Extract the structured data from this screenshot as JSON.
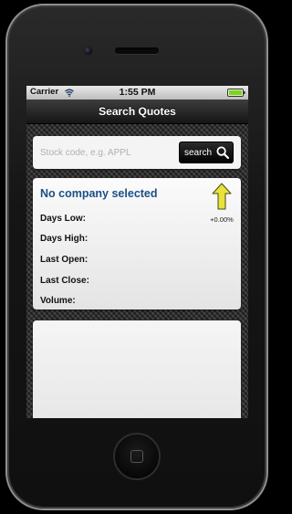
{
  "status_bar": {
    "carrier": "Carrier",
    "time": "1:55 PM"
  },
  "nav": {
    "title": "Search Quotes"
  },
  "search": {
    "placeholder": "Stock code, e.g. APPL",
    "button_label": "search"
  },
  "quote": {
    "company": "No company selected",
    "change": "+0.00%",
    "fields": [
      "Days Low:",
      "Days High:",
      "Last Open:",
      "Last Close:",
      "Volume:"
    ]
  },
  "colors": {
    "company_text": "#1b4f86",
    "arrow_fill": "#e8e23a",
    "battery_fill": "#7ed321"
  },
  "icons": {
    "wifi": "wifi-icon",
    "battery": "battery-icon",
    "search": "search-icon",
    "change_arrow": "up-arrow-icon"
  }
}
